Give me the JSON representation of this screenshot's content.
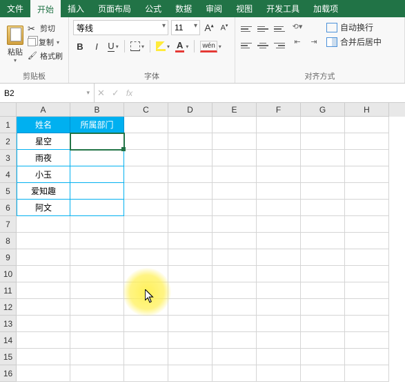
{
  "menu": {
    "tabs": [
      "文件",
      "开始",
      "插入",
      "页面布局",
      "公式",
      "数据",
      "审阅",
      "视图",
      "开发工具",
      "加载项"
    ],
    "active_index": 1
  },
  "ribbon": {
    "clipboard": {
      "paste": "粘贴",
      "cut": "剪切",
      "copy": "复制",
      "format_painter": "格式刷",
      "group_label": "剪贴板"
    },
    "font": {
      "font_name": "等线",
      "font_size": "11",
      "bold": "B",
      "italic": "I",
      "underline": "U",
      "color_letter": "A",
      "wen": "wén",
      "group_label": "字体",
      "grow": "A",
      "shrink": "A"
    },
    "align": {
      "wrap_text": "自动换行",
      "merge_center": "合并后居中",
      "group_label": "对齐方式"
    }
  },
  "formula_bar": {
    "name_box": "B2",
    "fx": "fx",
    "value": ""
  },
  "grid": {
    "cols": [
      "A",
      "B",
      "C",
      "D",
      "E",
      "F",
      "G",
      "H"
    ],
    "row_count": 16,
    "table": {
      "headers": [
        "姓名",
        "所属部门"
      ],
      "rows": [
        [
          "星空",
          ""
        ],
        [
          "雨夜",
          ""
        ],
        [
          "小玉",
          ""
        ],
        [
          "爱知趣",
          ""
        ],
        [
          "阿文",
          ""
        ]
      ]
    }
  }
}
